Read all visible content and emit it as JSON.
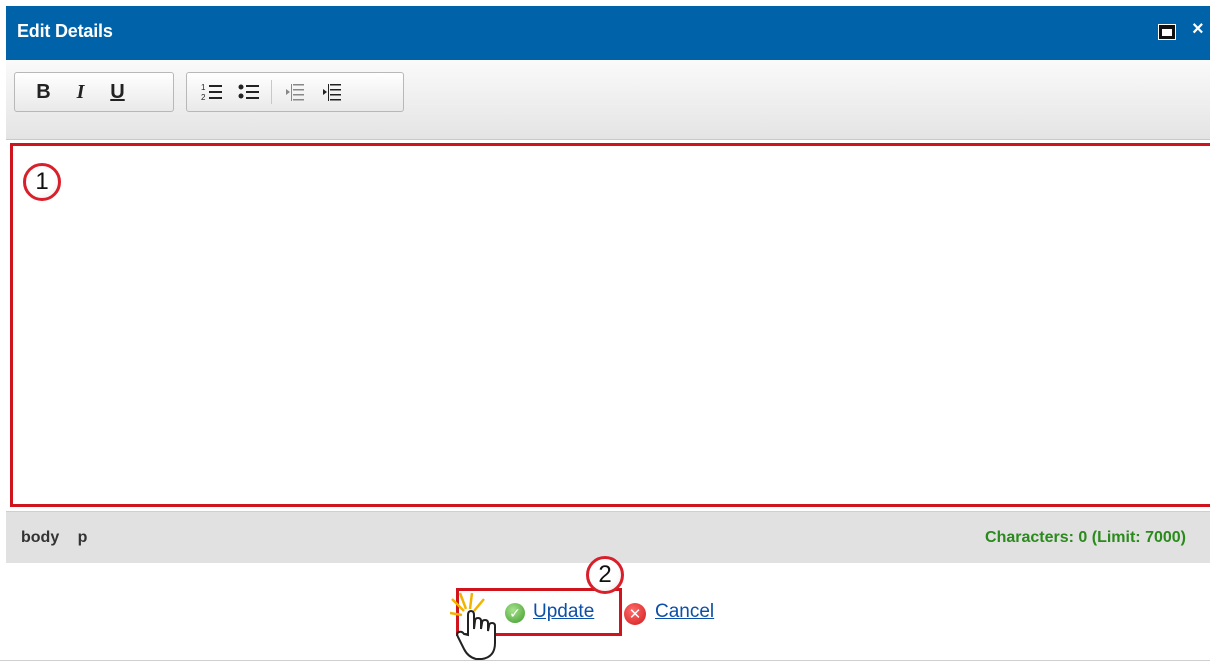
{
  "dialog": {
    "title": "Edit Details",
    "close_glyph": "×"
  },
  "toolbar": {
    "bold": "B",
    "italic": "I",
    "underline": "U",
    "icons": [
      "bold-icon",
      "italic-icon",
      "underline-icon",
      "numbered-list-icon",
      "bullet-list-icon",
      "outdent-icon",
      "indent-icon"
    ]
  },
  "editor": {
    "callout": "1"
  },
  "statusbar": {
    "path": [
      "body",
      "p"
    ],
    "counter": "Characters: 0 (Limit: 7000)"
  },
  "actions": {
    "callout": "2",
    "update": "Update",
    "cancel": "Cancel"
  },
  "colors": {
    "titlebar": "#0062a8",
    "highlight": "#d0141e",
    "counter": "#2a8a1c",
    "link": "#0b4fa8"
  }
}
